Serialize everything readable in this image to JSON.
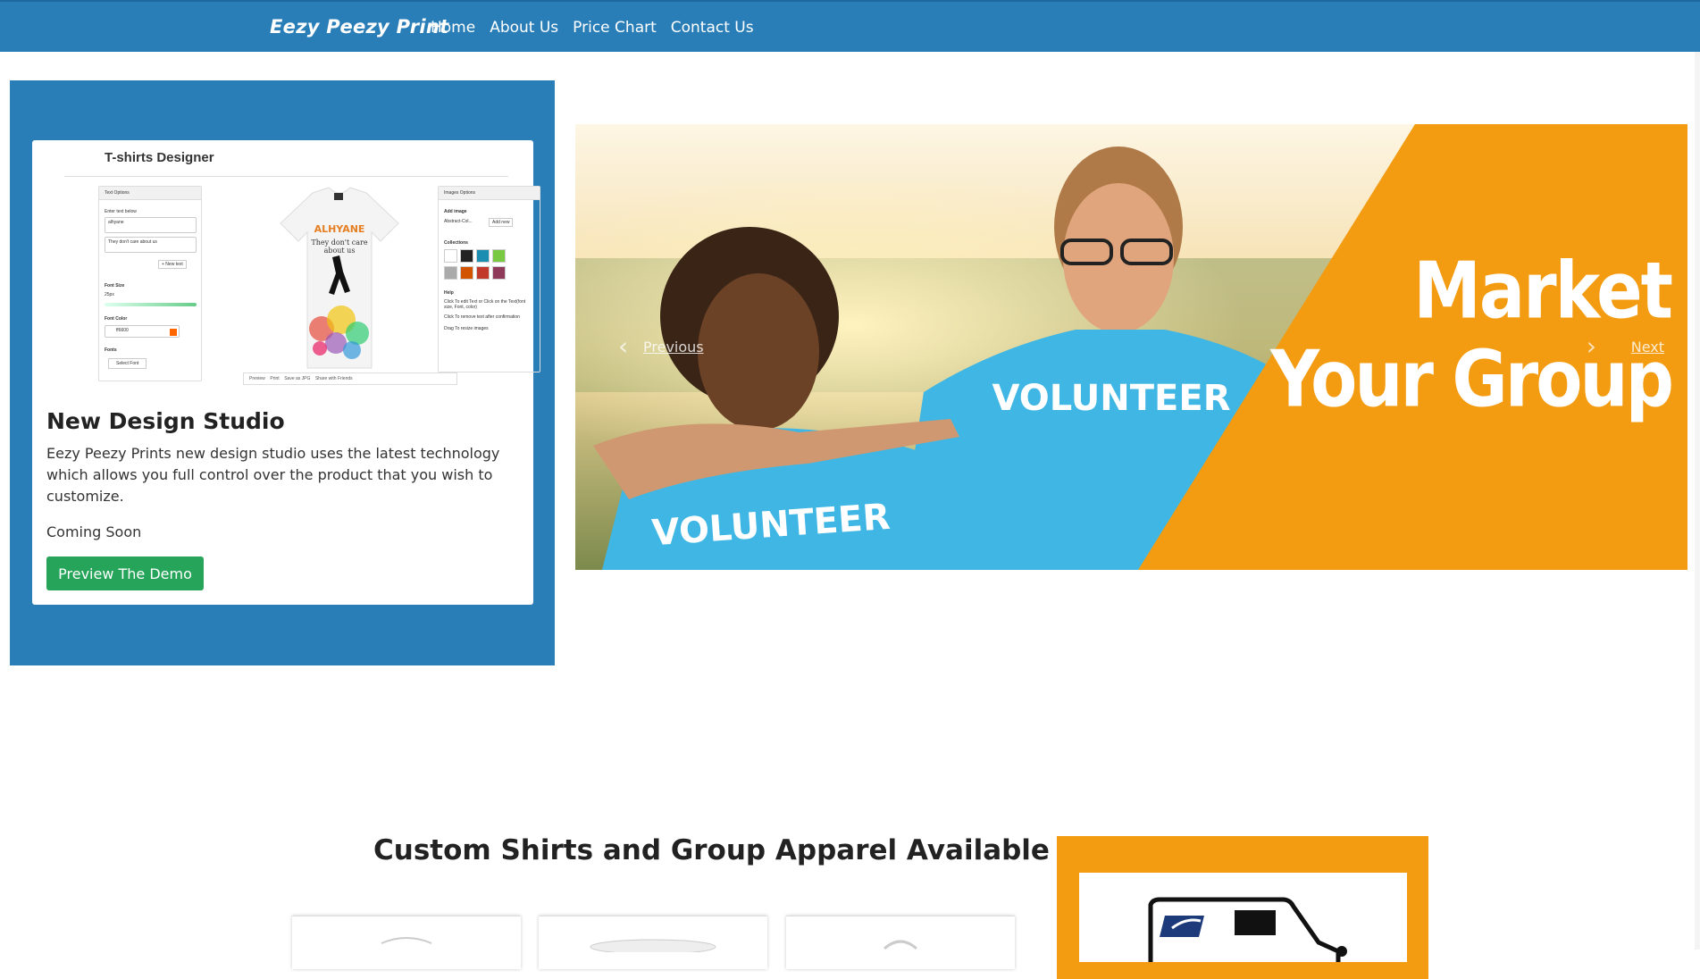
{
  "nav": {
    "brand": "Eezy Peezy Print",
    "links": [
      "Home",
      "About Us",
      "Price Chart",
      "Contact Us"
    ]
  },
  "feature": {
    "mockup_title": "T-shirts Designer",
    "mockup_left_panel": {
      "heading": "Text Options",
      "enter_text_label": "Enter text below",
      "text_value": "alhyane",
      "text_value_2": "They don't care about us",
      "new_text_button": "+ New text",
      "font_size_label": "Font Size",
      "font_size_value": "25px",
      "font_color_label": "Font Color",
      "font_color_value": "ff6600",
      "fonts_label": "Fonts",
      "select_font_button": "Select Font"
    },
    "mockup_right_panel": {
      "heading": "Images Options",
      "add_image_label": "Add image",
      "add_image_value": "Abstract-Col...",
      "add_new_button": "Add new",
      "collections_label": "Collections",
      "help_label": "Help",
      "help_1": "Click To edit Text or Click on the Text(font size, Font, color)",
      "help_2": "Click To remove text after confirmation",
      "help_3": "Drag To resize images"
    },
    "mockup_bottom": [
      "Preview",
      "Print",
      "Save as JPG",
      "Share with Friends"
    ],
    "tshirt_text": [
      "ALHYANE",
      "They don't care",
      "about us"
    ],
    "title": "New Design Studio",
    "description": "Eezy Peezy Prints new design studio uses the latest technology which allows you full control over the product that you wish to customize.",
    "status": "Coming Soon",
    "button_label": "Preview The Demo"
  },
  "carousel": {
    "prev_label": "Previous",
    "next_label": "Next",
    "banner_line1": "Market",
    "banner_line2": "Your Group",
    "shirt_text": "VOLUNTEER"
  },
  "section": {
    "title": "Custom Shirts and Group Apparel Available"
  },
  "colors": {
    "nav_blue": "#2a7eb8",
    "button_green": "#25a45a",
    "orange": "#f39c12",
    "shirt_blue": "#3fb6e3"
  }
}
